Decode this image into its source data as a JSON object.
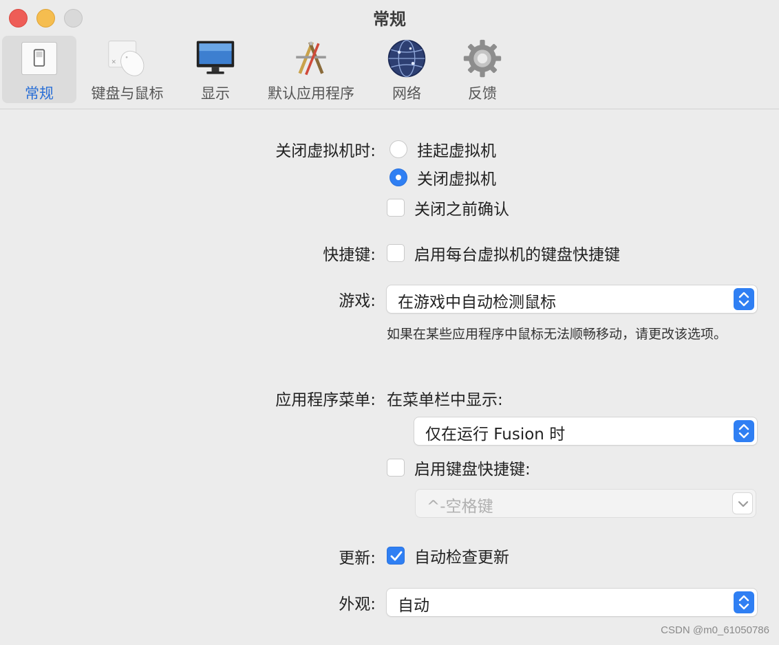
{
  "window": {
    "title": "常规"
  },
  "toolbar": {
    "tabs": [
      {
        "label": "常规",
        "icon": "switch-icon",
        "active": true
      },
      {
        "label": "键盘与鼠标",
        "icon": "mouse-icon"
      },
      {
        "label": "显示",
        "icon": "display-icon"
      },
      {
        "label": "默认应用程序",
        "icon": "applications-icon"
      },
      {
        "label": "网络",
        "icon": "globe-icon"
      },
      {
        "label": "反馈",
        "icon": "gear-icon"
      }
    ]
  },
  "close_vm": {
    "label": "关闭虚拟机时:",
    "suspend_option": "挂起虚拟机",
    "shutdown_option": "关闭虚拟机",
    "confirm_label": "关闭之前确认",
    "selected": "关闭虚拟机",
    "confirm_checked": false
  },
  "shortcuts": {
    "label": "快捷键:",
    "enable_label": "启用每台虚拟机的键盘快捷键",
    "checked": false
  },
  "gaming": {
    "label": "游戏:",
    "value": "在游戏中自动检测鼠标",
    "help": "如果在某些应用程序中鼠标无法顺畅移动，请更改该选项。"
  },
  "app_menu": {
    "label": "应用程序菜单:",
    "show_in_menubar_label": "在菜单栏中显示:",
    "show_value": "仅在运行 Fusion 时",
    "enable_shortcut_label": "启用键盘快捷键:",
    "enable_shortcut_checked": false,
    "shortcut_value": "^-空格键"
  },
  "updates": {
    "label": "更新:",
    "auto_check_label": "自动检查更新",
    "checked": true
  },
  "appearance": {
    "label": "外观:",
    "value": "自动"
  },
  "watermark": "CSDN @m0_61050786",
  "colors": {
    "accent": "#2f7ff3",
    "active_tab_text": "#2a6fd6"
  }
}
